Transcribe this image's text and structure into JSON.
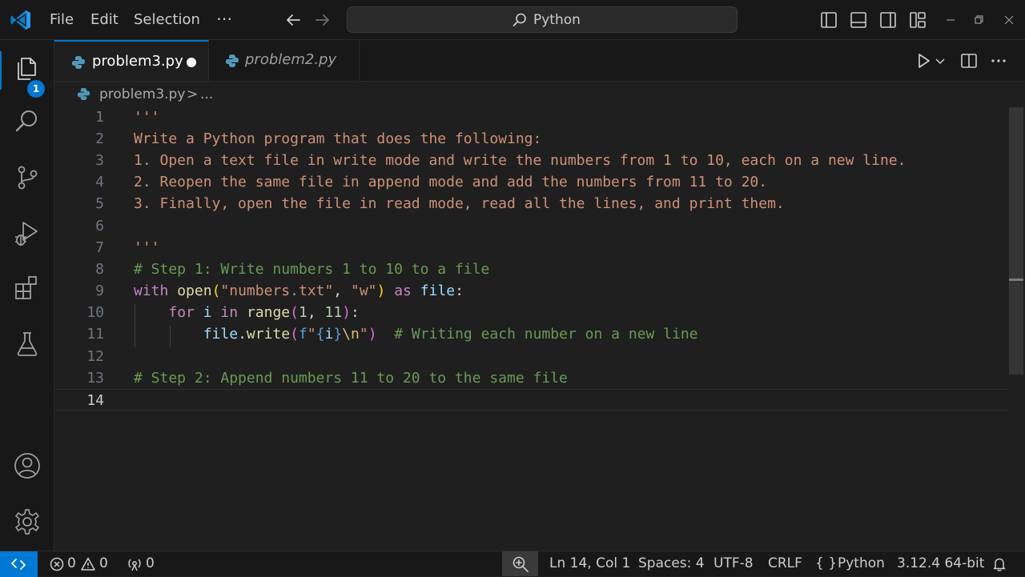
{
  "menu": {
    "file": "File",
    "edit": "Edit",
    "selection": "Selection",
    "more": "⋯"
  },
  "command_center": {
    "label": "Python"
  },
  "activity": {
    "explorer_badge": "1"
  },
  "tabs": [
    {
      "label": "problem3.py",
      "active": true,
      "dirty": true
    },
    {
      "label": "problem2.py",
      "active": false,
      "dirty": false
    }
  ],
  "breadcrumb": {
    "file": "problem3.py",
    "separator": ">",
    "more": "..."
  },
  "editor": {
    "current_line": 14,
    "lines": [
      {
        "n": "1",
        "tokens": [
          {
            "t": "'''",
            "c": "string"
          }
        ]
      },
      {
        "n": "2",
        "tokens": [
          {
            "t": "Write a Python program that does the following:",
            "c": "string"
          }
        ]
      },
      {
        "n": "3",
        "tokens": [
          {
            "t": "1. Open a text file in write mode and write the numbers from 1 to 10, each on a new line.",
            "c": "string"
          }
        ]
      },
      {
        "n": "4",
        "tokens": [
          {
            "t": "2. Reopen the same file in append mode and add the numbers from 11 to 20.",
            "c": "string"
          }
        ]
      },
      {
        "n": "5",
        "tokens": [
          {
            "t": "3. Finally, open the file in read mode, read all the lines, and print them.",
            "c": "string"
          }
        ]
      },
      {
        "n": "6",
        "tokens": []
      },
      {
        "n": "7",
        "tokens": [
          {
            "t": "'''",
            "c": "string"
          }
        ]
      },
      {
        "n": "8",
        "tokens": [
          {
            "t": "# Step 1: Write numbers 1 to 10 to a file",
            "c": "comment"
          }
        ]
      },
      {
        "n": "9",
        "tokens": [
          {
            "t": "with",
            "c": "kw"
          },
          {
            "t": " ",
            "c": "plain"
          },
          {
            "t": "open",
            "c": "fn"
          },
          {
            "t": "(",
            "c": "brace1"
          },
          {
            "t": "\"numbers.txt\"",
            "c": "string"
          },
          {
            "t": ", ",
            "c": "plain"
          },
          {
            "t": "\"w\"",
            "c": "string"
          },
          {
            "t": ")",
            "c": "brace1"
          },
          {
            "t": " ",
            "c": "plain"
          },
          {
            "t": "as",
            "c": "kw"
          },
          {
            "t": " ",
            "c": "plain"
          },
          {
            "t": "file",
            "c": "var"
          },
          {
            "t": ":",
            "c": "plain"
          }
        ]
      },
      {
        "n": "10",
        "tokens": [
          {
            "t": "    ",
            "c": "plain"
          },
          {
            "t": "for",
            "c": "kw"
          },
          {
            "t": " ",
            "c": "plain"
          },
          {
            "t": "i",
            "c": "var"
          },
          {
            "t": " ",
            "c": "plain"
          },
          {
            "t": "in",
            "c": "kw"
          },
          {
            "t": " ",
            "c": "plain"
          },
          {
            "t": "range",
            "c": "fn"
          },
          {
            "t": "(",
            "c": "brace2"
          },
          {
            "t": "1",
            "c": "num"
          },
          {
            "t": ", ",
            "c": "plain"
          },
          {
            "t": "11",
            "c": "num"
          },
          {
            "t": ")",
            "c": "brace2"
          },
          {
            "t": ":",
            "c": "plain"
          }
        ]
      },
      {
        "n": "11",
        "tokens": [
          {
            "t": "        ",
            "c": "plain"
          },
          {
            "t": "file",
            "c": "var"
          },
          {
            "t": ".",
            "c": "plain"
          },
          {
            "t": "write",
            "c": "fn"
          },
          {
            "t": "(",
            "c": "brace2"
          },
          {
            "t": "f",
            "c": "fkw"
          },
          {
            "t": "\"",
            "c": "string"
          },
          {
            "t": "{",
            "c": "fkw"
          },
          {
            "t": "i",
            "c": "var"
          },
          {
            "t": "}",
            "c": "fkw"
          },
          {
            "t": "\\n",
            "c": "escape"
          },
          {
            "t": "\"",
            "c": "string"
          },
          {
            "t": ")",
            "c": "brace2"
          },
          {
            "t": "  ",
            "c": "plain"
          },
          {
            "t": "# Writing each number on a new line",
            "c": "comment"
          }
        ]
      },
      {
        "n": "12",
        "tokens": []
      },
      {
        "n": "13",
        "tokens": [
          {
            "t": "# Step 2: Append numbers 11 to 20 to the same file",
            "c": "comment"
          }
        ]
      },
      {
        "n": "14",
        "tokens": []
      }
    ]
  },
  "status": {
    "errors": "0",
    "warnings": "0",
    "ports": "0",
    "position": "Ln 14, Col 1",
    "spaces": "Spaces: 4",
    "encoding": "UTF-8",
    "eol": "CRLF",
    "language_braces": "{ }",
    "language": "Python",
    "interpreter": "3.12.4 64-bit"
  },
  "colors": {
    "accent": "#0078d4",
    "string": "#ce9178",
    "comment": "#6a9955",
    "keyword": "#c586c0",
    "function": "#dcdcaa",
    "variable": "#9cdcfe",
    "number": "#b5cea8"
  },
  "icons": [
    "vscode-logo",
    "arrow-left-icon",
    "arrow-right-icon",
    "search-icon",
    "toggle-primary-sidebar-icon",
    "toggle-panel-icon",
    "toggle-secondary-sidebar-icon",
    "customize-layout-icon",
    "minimize-icon",
    "restore-icon",
    "close-icon",
    "explorer-icon",
    "search-view-icon",
    "source-control-icon",
    "run-debug-icon",
    "extensions-icon",
    "testing-icon",
    "account-icon",
    "manage-gear-icon",
    "python-file-icon",
    "run-icon",
    "chevron-down-icon",
    "split-editor-icon",
    "more-actions-icon",
    "remote-icon",
    "error-icon",
    "warning-icon",
    "ports-icon",
    "zoom-icon",
    "bell-icon"
  ]
}
